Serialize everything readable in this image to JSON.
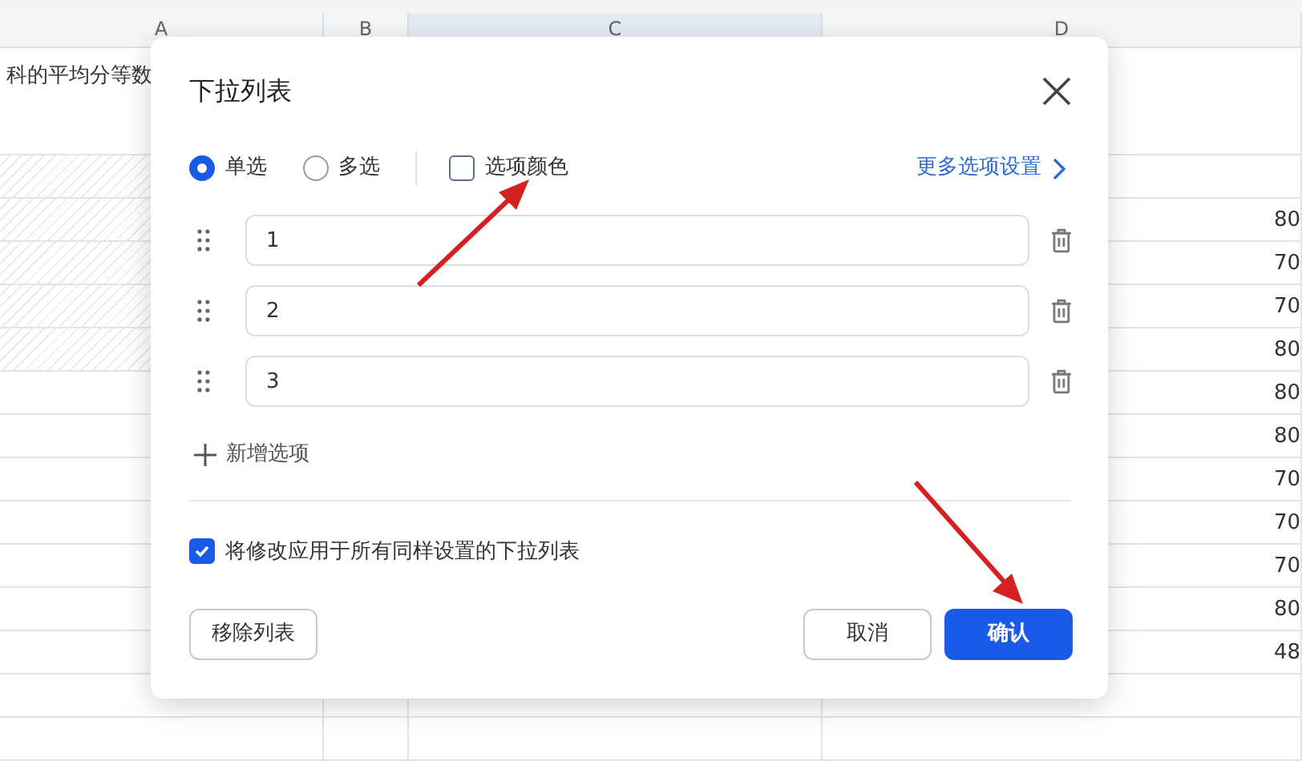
{
  "spreadsheet": {
    "columns": [
      {
        "label": "A",
        "selected": false
      },
      {
        "label": "B",
        "selected": false
      },
      {
        "label": "C",
        "selected": true
      },
      {
        "label": "D",
        "selected": false
      }
    ],
    "rows": [
      {
        "hatched": false,
        "cells": [
          "科的平均分等数",
          "",
          "",
          ""
        ]
      },
      {
        "hatched": true,
        "cells": [
          "",
          "",
          "",
          ""
        ]
      },
      {
        "hatched": true,
        "cells": [
          "",
          "",
          "",
          "80"
        ]
      },
      {
        "hatched": true,
        "cells": [
          "",
          "",
          "",
          "70"
        ]
      },
      {
        "hatched": true,
        "cells": [
          "",
          "",
          "",
          "70"
        ]
      },
      {
        "hatched": true,
        "cells": [
          "",
          "",
          "",
          "80"
        ]
      },
      {
        "hatched": false,
        "cells": [
          "",
          "",
          "",
          "80"
        ]
      },
      {
        "hatched": false,
        "cells": [
          "",
          "",
          "",
          "80"
        ]
      },
      {
        "hatched": false,
        "cells": [
          "",
          "",
          "",
          "70"
        ]
      },
      {
        "hatched": false,
        "cells": [
          "",
          "",
          "",
          "70"
        ]
      },
      {
        "hatched": false,
        "cells": [
          "",
          "",
          "",
          "70"
        ]
      },
      {
        "hatched": false,
        "cells": [
          "",
          "",
          "",
          "80"
        ]
      },
      {
        "hatched": false,
        "cells": [
          "",
          "",
          "",
          "48"
        ]
      },
      {
        "hatched": false,
        "cells": [
          "",
          "",
          "",
          ""
        ]
      },
      {
        "hatched": false,
        "cells": [
          "",
          "",
          "",
          ""
        ]
      }
    ]
  },
  "dialog": {
    "title": "下拉列表",
    "mode_options": [
      {
        "label": "单选",
        "selected": true
      },
      {
        "label": "多选",
        "selected": false
      }
    ],
    "option_color": {
      "label": "选项颜色",
      "checked": false
    },
    "more_settings_link": "更多选项设置",
    "options": [
      {
        "value": "1"
      },
      {
        "value": "2"
      },
      {
        "value": "3"
      }
    ],
    "add_option": "新增选项",
    "apply_all": {
      "label": "将修改应用于所有同样设置的下拉列表",
      "checked": true
    },
    "buttons": [
      {
        "label": "移除列表",
        "kind": "secondary"
      },
      {
        "label": "取消",
        "kind": "secondary"
      },
      {
        "label": "确认",
        "kind": "primary"
      }
    ]
  }
}
